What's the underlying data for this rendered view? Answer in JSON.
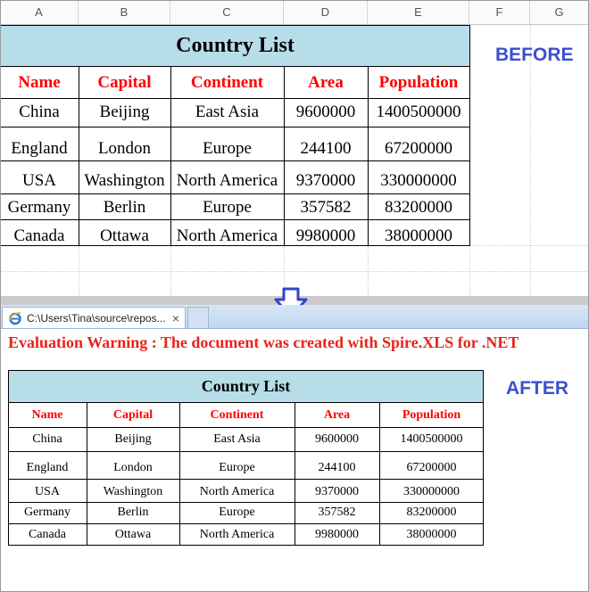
{
  "spreadsheet": {
    "column_headers": [
      "A",
      "B",
      "C",
      "D",
      "E",
      "F",
      "G"
    ],
    "before_label": "BEFORE"
  },
  "table": {
    "title": "Country List",
    "headers": [
      "Name",
      "Capital",
      "Continent",
      "Area",
      "Population"
    ],
    "rows": [
      [
        "China",
        "Beijing",
        "East Asia",
        "9600000",
        "1400500000"
      ],
      [
        "England",
        "London",
        "Europe",
        "244100",
        "67200000"
      ],
      [
        "USA",
        "Washington",
        "North America",
        "9370000",
        "330000000"
      ],
      [
        "Germany",
        "Berlin",
        "Europe",
        "357582",
        "83200000"
      ],
      [
        "Canada",
        "Ottawa",
        "North America",
        "9980000",
        "38000000"
      ]
    ]
  },
  "browser": {
    "tab_title": "C:\\Users\\Tina\\source\\repos...",
    "close_icon": "×",
    "warning": "Evaluation Warning : The document was created with  Spire.XLS for .NET",
    "after_label": "AFTER"
  },
  "colors": {
    "title_fill": "#b7dde8",
    "header_text": "#ff0000",
    "warning_text": "#e8231b",
    "label_text": "#3b4fcf",
    "arrow": "#3345c8"
  }
}
